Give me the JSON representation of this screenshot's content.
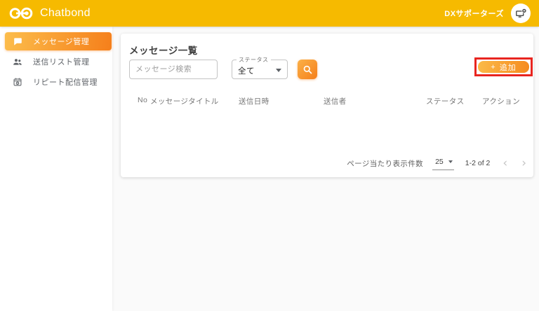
{
  "header": {
    "brand": "Chatbond",
    "user_label": "DXサポーターズ"
  },
  "sidebar": {
    "items": [
      {
        "label": "メッセージ管理",
        "icon": "chat-bubble-icon",
        "selected": true
      },
      {
        "label": "送信リスト管理",
        "icon": "people-icon",
        "selected": false
      },
      {
        "label": "リピート配信管理",
        "icon": "calendar-repeat-icon",
        "selected": false
      }
    ]
  },
  "main": {
    "title": "メッセージ一覧",
    "search_placeholder": "メッセージ検索",
    "status_filter": {
      "label": "ステータス",
      "value": "全て"
    },
    "add_button": {
      "icon": "+",
      "label": "追加"
    },
    "table": {
      "columns": [
        "No",
        "メッセージタイトル",
        "送信日時",
        "送信者",
        "ステータス",
        "アクション"
      ],
      "rows": []
    },
    "pagination": {
      "rows_per_page_label": "ページ当たり表示件数",
      "rows_per_page_value": "25",
      "range_label": "1-2 of 2",
      "prev": "‹",
      "next": "›"
    }
  },
  "colors": {
    "appbar": "#f6ba00",
    "accent_gradient_start": "#fcbd4b",
    "accent_gradient_end": "#f57f1b",
    "highlight_red": "#e8251f"
  }
}
